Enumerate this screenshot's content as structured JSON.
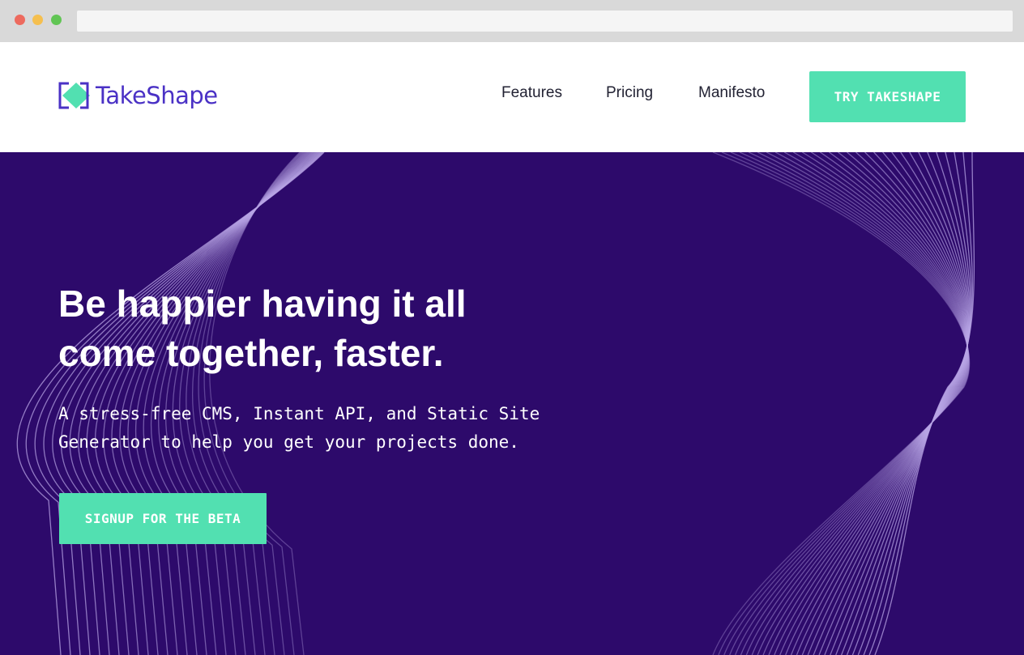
{
  "brand": {
    "name": "TakeShape",
    "logo_icon": "takeshape-logo-icon",
    "text_color": "#4a31c5"
  },
  "nav": {
    "links": [
      {
        "label": "Features"
      },
      {
        "label": "Pricing"
      },
      {
        "label": "Manifesto"
      }
    ],
    "cta_label": "TRY TAKESHAPE"
  },
  "hero": {
    "headline": "Be happier having it all come together, faster.",
    "subheadline": "A stress-free CMS, Instant API, and Static Site Generator to help you get your projects done.",
    "cta_label": "SIGNUP FOR THE BETA",
    "background_color": "#2d0a6b",
    "accent_color": "#52e0b1"
  }
}
